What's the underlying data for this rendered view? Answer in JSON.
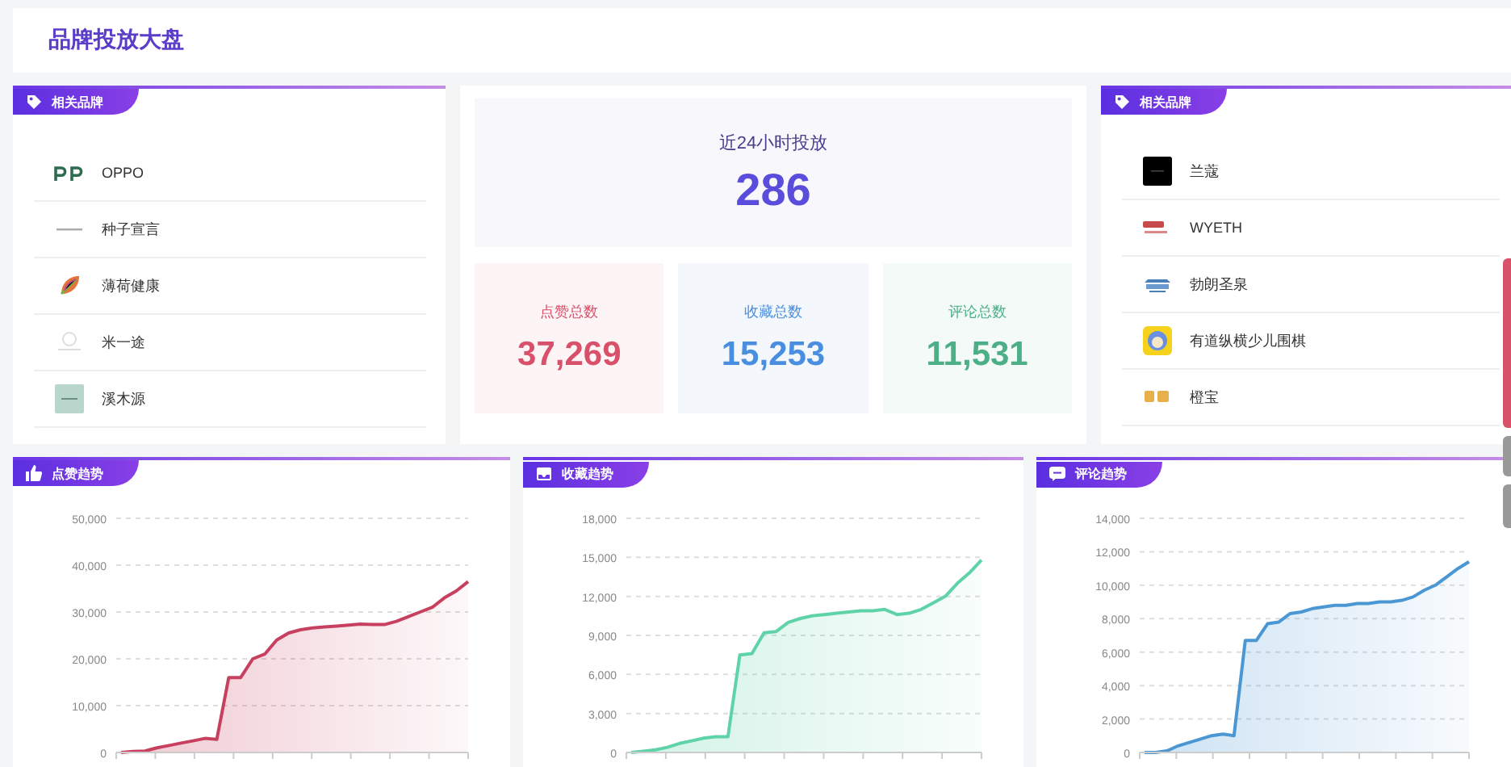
{
  "header": {
    "title": "品牌投放大盘"
  },
  "left_brands": {
    "title": "相关品牌",
    "brands": [
      {
        "name": "OPPO"
      },
      {
        "name": "种子宣言"
      },
      {
        "name": "薄荷健康"
      },
      {
        "name": "米一途"
      },
      {
        "name": "溪木源"
      }
    ]
  },
  "overview": {
    "label": "近24小时投放",
    "value": "286",
    "stats": [
      {
        "label": "点赞总数",
        "value": "37,269",
        "color": "#d9506a"
      },
      {
        "label": "收藏总数",
        "value": "15,253",
        "color": "#4a8ee0"
      },
      {
        "label": "评论总数",
        "value": "11,531",
        "color": "#4caf87"
      }
    ]
  },
  "right_brands": {
    "title": "相关品牌",
    "brands": [
      {
        "name": "兰蔻"
      },
      {
        "name": "WYETH"
      },
      {
        "name": "勃朗圣泉"
      },
      {
        "name": "有道纵横少儿围棋"
      },
      {
        "name": "橙宝"
      }
    ]
  },
  "side_tabs": [
    {
      "selected": true
    },
    {
      "selected": false
    },
    {
      "selected": false
    }
  ],
  "trend_charts": [
    {
      "title": "点赞趋势",
      "chart_data": {
        "type": "area",
        "grid": true,
        "ylim": [
          0,
          50000
        ],
        "yticks": [
          {
            "value": 0,
            "label": "0"
          },
          {
            "value": 10000,
            "label": "10,000"
          },
          {
            "value": 20000,
            "label": "20,000"
          },
          {
            "value": 30000,
            "label": "30,000"
          },
          {
            "value": 40000,
            "label": "40,000"
          },
          {
            "value": 50000,
            "label": "50,000"
          }
        ],
        "series": [
          {
            "color": "#c8405f",
            "values": [
              0,
              200,
              300,
              1000,
              1500,
              2000,
              2500,
              3000,
              2800,
              16000,
              16000,
              20000,
              21000,
              24000,
              25500,
              26200,
              26600,
              26800,
              27000,
              27200,
              27400,
              27300,
              27300,
              28000,
              29000,
              30000,
              31000,
              33000,
              34500,
              36500
            ]
          }
        ]
      }
    },
    {
      "title": "收藏趋势",
      "chart_data": {
        "type": "area",
        "grid": true,
        "ylim": [
          0,
          18000
        ],
        "yticks": [
          {
            "value": 0,
            "label": "0"
          },
          {
            "value": 3000,
            "label": "3,000"
          },
          {
            "value": 6000,
            "label": "6,000"
          },
          {
            "value": 9000,
            "label": "9,000"
          },
          {
            "value": 12000,
            "label": "12,000"
          },
          {
            "value": 15000,
            "label": "15,000"
          },
          {
            "value": 18000,
            "label": "18,000"
          }
        ],
        "series": [
          {
            "color": "#5fd3a8",
            "values": [
              0,
              100,
              200,
              400,
              700,
              900,
              1100,
              1200,
              1200,
              7500,
              7600,
              9200,
              9300,
              10000,
              10300,
              10500,
              10600,
              10700,
              10800,
              10900,
              10900,
              11000,
              10600,
              10700,
              11000,
              11500,
              12000,
              13000,
              13800,
              14800
            ]
          }
        ]
      }
    },
    {
      "title": "评论趋势",
      "chart_data": {
        "type": "area",
        "grid": true,
        "ylim": [
          0,
          14000
        ],
        "yticks": [
          {
            "value": 0,
            "label": "0"
          },
          {
            "value": 2000,
            "label": "2,000"
          },
          {
            "value": 4000,
            "label": "4,000"
          },
          {
            "value": 6000,
            "label": "6,000"
          },
          {
            "value": 8000,
            "label": "8,000"
          },
          {
            "value": 10000,
            "label": "10,000"
          },
          {
            "value": 12000,
            "label": "12,000"
          },
          {
            "value": 14000,
            "label": "14,000"
          }
        ],
        "series": [
          {
            "color": "#4a97d4",
            "values": [
              0,
              0,
              100,
              400,
              600,
              800,
              1000,
              1100,
              1000,
              6700,
              6700,
              7700,
              7800,
              8300,
              8400,
              8600,
              8700,
              8800,
              8800,
              8900,
              8900,
              9000,
              9000,
              9100,
              9300,
              9700,
              10000,
              10500,
              11000,
              11400
            ]
          }
        ]
      }
    }
  ]
}
